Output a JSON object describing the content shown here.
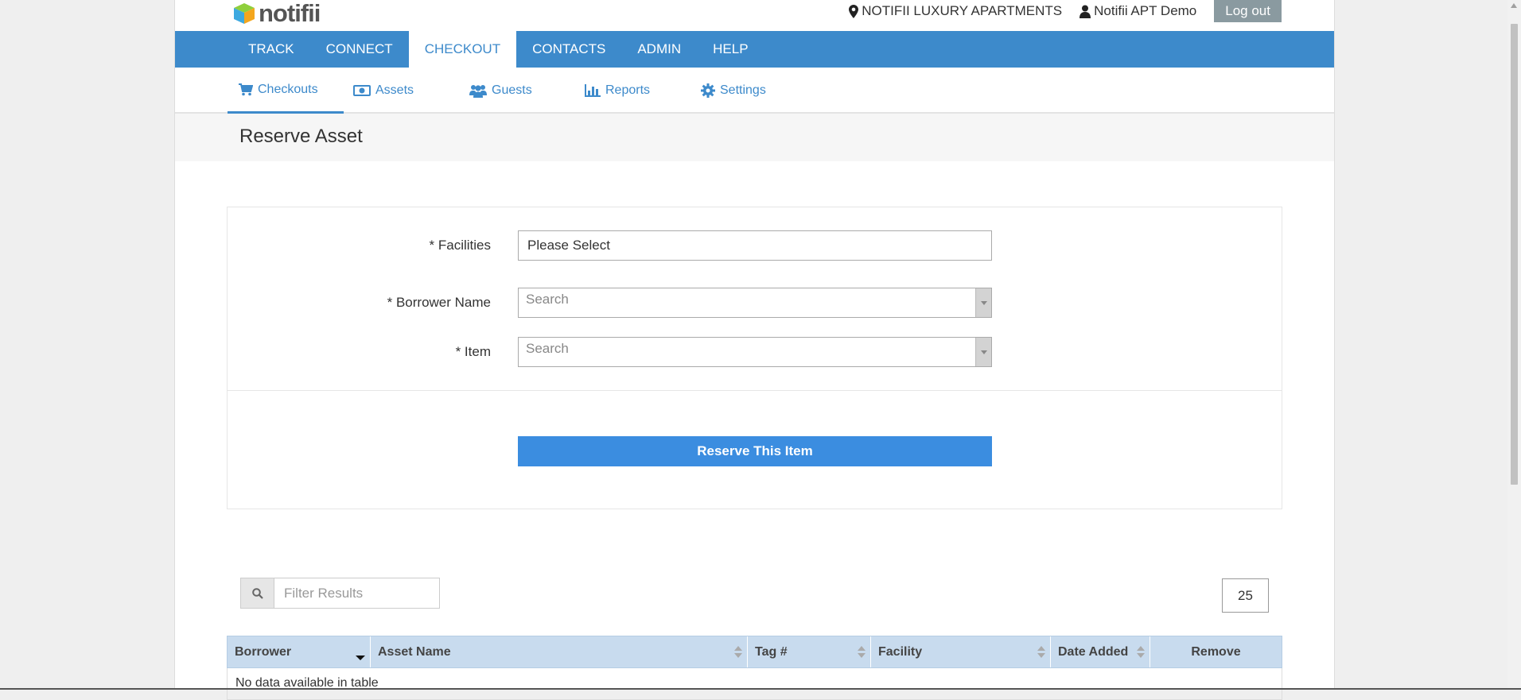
{
  "brand": {
    "name": "notifii"
  },
  "topbar": {
    "location": "NOTIFII LUXURY APARTMENTS",
    "user": "Notifii APT Demo",
    "logout_label": "Log out"
  },
  "mainnav": {
    "items": [
      "TRACK",
      "CONNECT",
      "CHECKOUT",
      "CONTACTS",
      "ADMIN",
      "HELP"
    ],
    "active": "CHECKOUT"
  },
  "subnav": {
    "items": [
      {
        "label": "Checkouts",
        "icon": "cart-icon"
      },
      {
        "label": "Assets",
        "icon": "money-icon"
      },
      {
        "label": "Guests",
        "icon": "users-icon"
      },
      {
        "label": "Reports",
        "icon": "bar-chart-icon"
      },
      {
        "label": "Settings",
        "icon": "gear-icon"
      }
    ],
    "active": "Checkouts"
  },
  "page": {
    "title": "Reserve Asset"
  },
  "form": {
    "facilities_label": "* Facilities",
    "facilities_value": "Please Select",
    "borrower_label": "* Borrower Name",
    "borrower_placeholder": "Search",
    "item_label": "* Item",
    "item_placeholder": "Search",
    "submit_label": "Reserve This Item"
  },
  "filter": {
    "placeholder": "Filter Results",
    "page_size": "25"
  },
  "table": {
    "columns": [
      "Borrower",
      "Asset Name",
      "Tag #",
      "Facility",
      "Date Added",
      "Remove"
    ],
    "empty_text": "No data available in table"
  },
  "colors": {
    "accent": "#3d8acb",
    "button": "#3b8de0",
    "table_header": "#c8dbee"
  }
}
